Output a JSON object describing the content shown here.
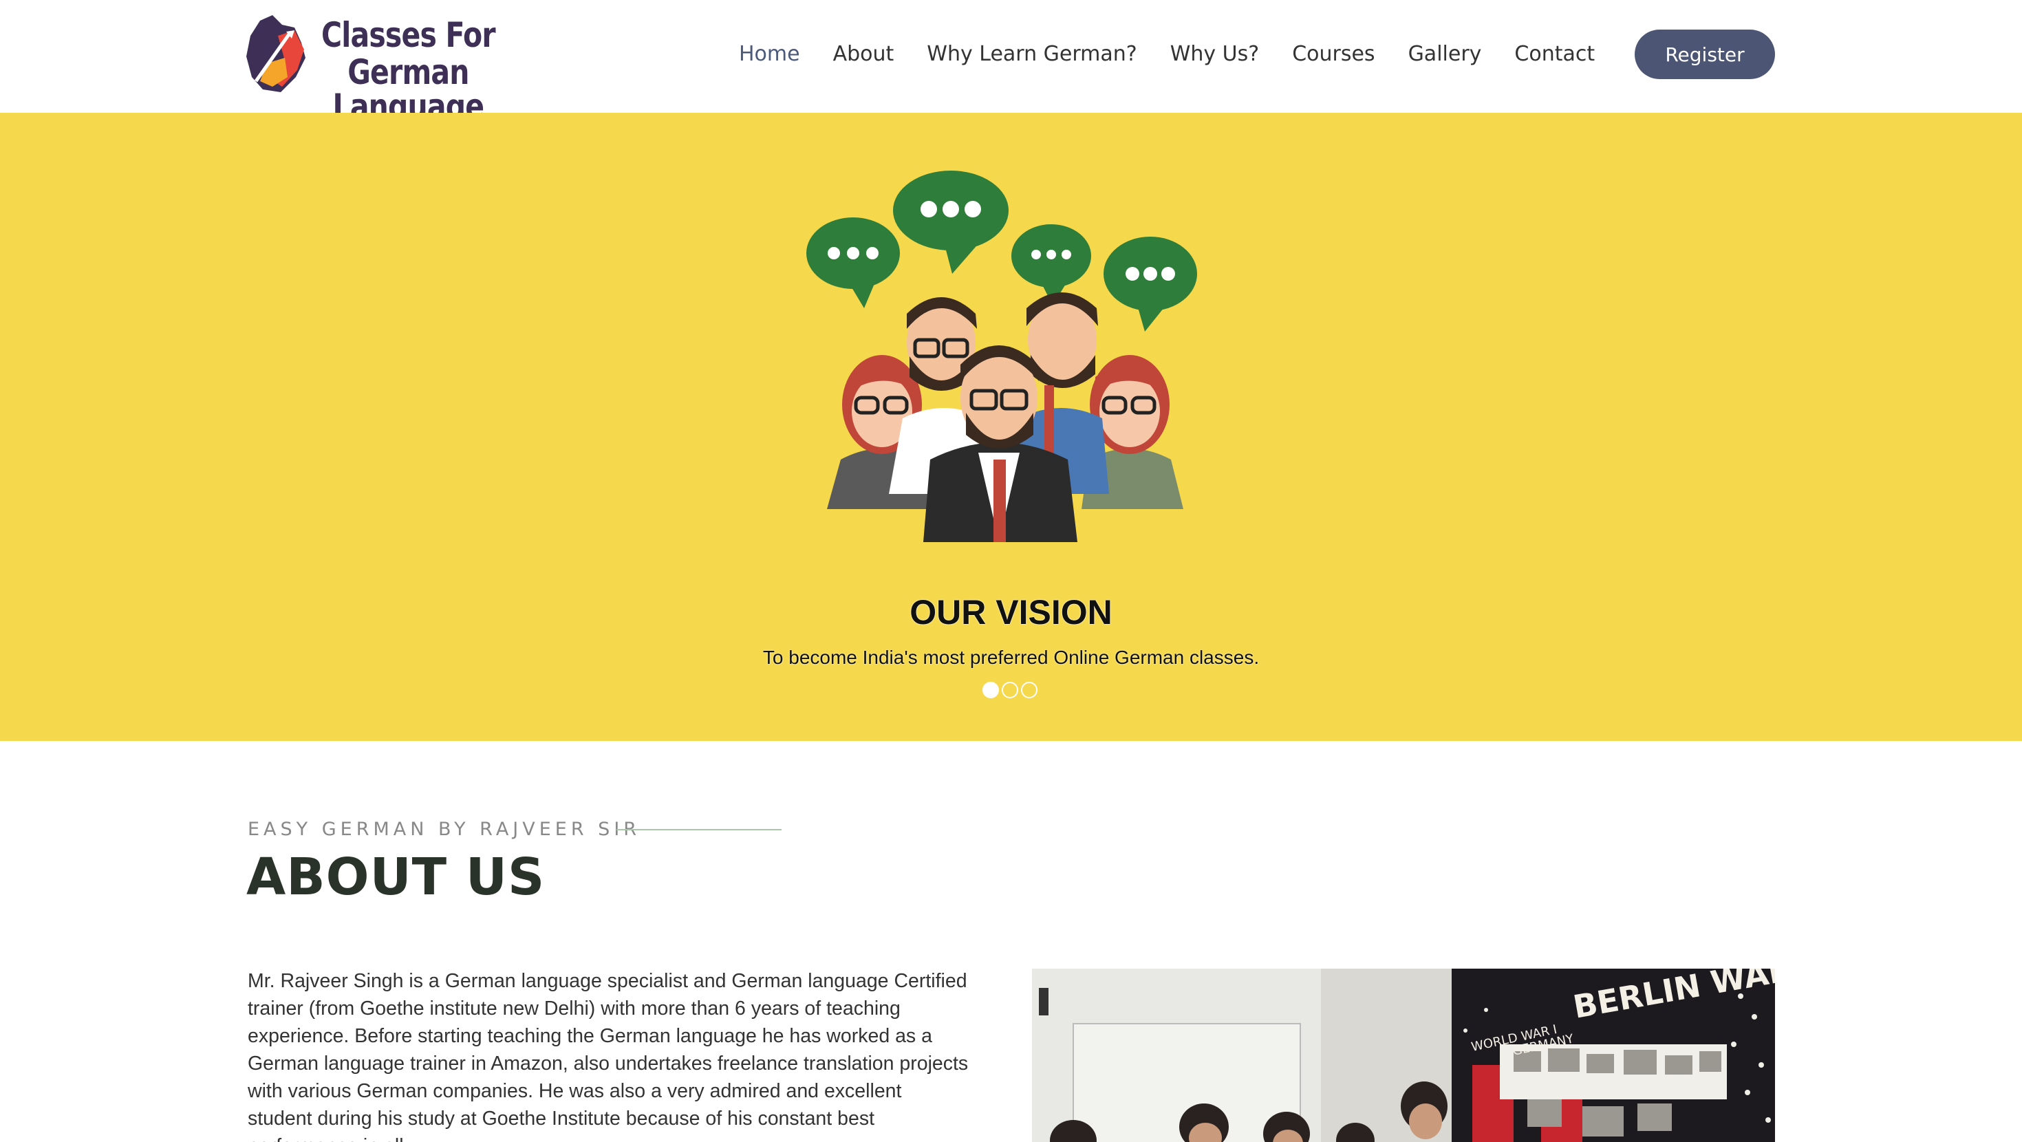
{
  "header": {
    "logo": {
      "line1": "Classes For",
      "line2": "German Language"
    },
    "nav": [
      {
        "label": "Home",
        "active": true
      },
      {
        "label": "About"
      },
      {
        "label": "Why Learn German?"
      },
      {
        "label": "Why Us?"
      },
      {
        "label": "Courses"
      },
      {
        "label": "Gallery"
      },
      {
        "label": "Contact"
      }
    ],
    "register_label": "Register"
  },
  "hero": {
    "title": "OUR VISION",
    "text": "To become India's most preferred Online German classes.",
    "slide_count": 3,
    "active_slide": 1,
    "background": "#f5d84b"
  },
  "about": {
    "eyebrow": "EASY GERMAN BY RAJVEER SIR",
    "title": "ABOUT US",
    "body": "Mr. Rajveer Singh is a German language specialist and German language Certified trainer (from Goethe institute new Delhi) with more than 6 years of teaching experience. Before starting teaching the German language he has worked as a German language trainer in Amazon, also undertakes freelance translation projects with various German companies. He was also a very admired and excellent student during his study at Goethe Institute because of his constant best performance in all",
    "photo_texts": {
      "banner": "BERLIN WALL",
      "label1": "WORLD WAR I",
      "label2": "GERMANY"
    }
  },
  "colors": {
    "accent": "#4c5674",
    "hero_bg": "#f5d84b",
    "heading": "#2a332a"
  }
}
